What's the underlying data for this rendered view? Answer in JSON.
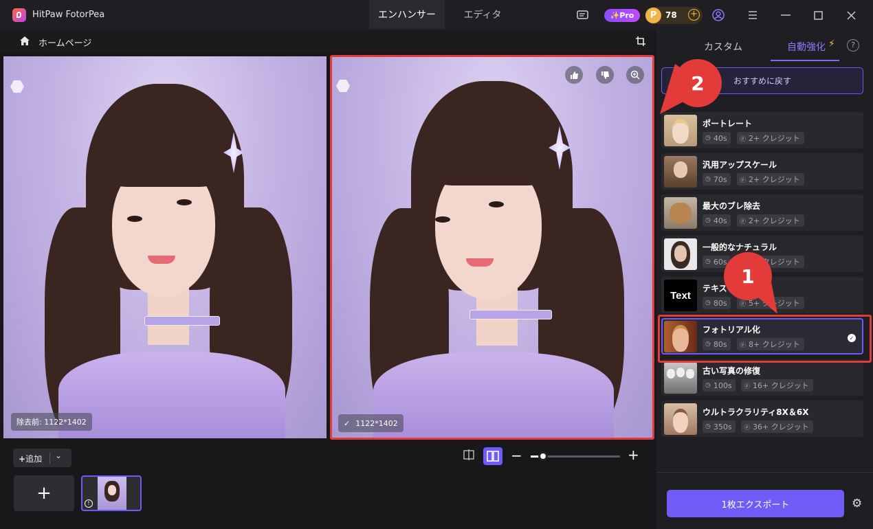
{
  "app": {
    "title": "HitPaw FotorPea"
  },
  "toptabs": {
    "enhancer": "エンハンサー",
    "editor": "エディタ"
  },
  "titlebar": {
    "pro": "✨Pro",
    "coin_symbol": "P",
    "credits": "78",
    "plus": "+",
    "icons": [
      "chat-icon",
      "profile-icon",
      "menu-icon",
      "minimize-icon",
      "maximize-icon",
      "close-icon"
    ]
  },
  "nav": {
    "home": "ホームページ"
  },
  "preview": {
    "before_label": "除去前: 1122*1402",
    "after_label": "1122*1402"
  },
  "bottom": {
    "add": "追加",
    "new_tile": "+"
  },
  "panel": {
    "tab_custom": "カスタム",
    "tab_auto": "自動強化",
    "reset": "おすすめに戻す",
    "export": "1枚エクスポート",
    "models": [
      {
        "name": "ポートレート",
        "time": "40s",
        "credits": "2+ クレジット",
        "selected": false
      },
      {
        "name": "汎用アップスケール",
        "time": "70s",
        "credits": "2+ クレジット",
        "selected": false
      },
      {
        "name": "最大のブレ除去",
        "time": "40s",
        "credits": "2+ クレジット",
        "selected": false
      },
      {
        "name": "一般的なナチュラル",
        "time": "60s",
        "credits": "2+ クレジット",
        "selected": false
      },
      {
        "name": "テキスト",
        "time": "80s",
        "credits": "5+ クレジット",
        "selected": false
      },
      {
        "name": "フォトリアル化",
        "time": "80s",
        "credits": "8+ クレジット",
        "selected": true
      },
      {
        "name": "古い写真の修復",
        "time": "100s",
        "credits": "16+ クレジット",
        "selected": false
      },
      {
        "name": "ウルトラクラリティ8X＆6X",
        "time": "350s",
        "credits": "36+ クレジット",
        "selected": false
      }
    ],
    "text_thumb": "Text"
  },
  "annotations": {
    "badge1": "1",
    "badge2": "2"
  },
  "zoom": {
    "level": 0.1
  },
  "colors": {
    "accent": "#6f5cf6",
    "highlight": "#e33a3a"
  }
}
